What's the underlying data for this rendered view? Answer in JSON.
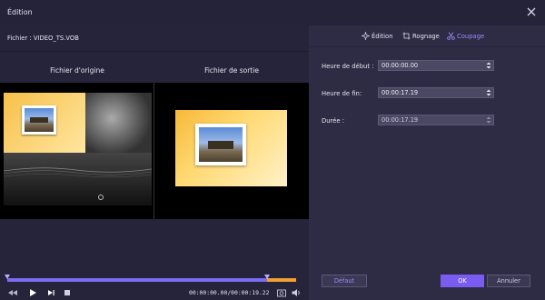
{
  "window": {
    "title": "Édition"
  },
  "file": {
    "label": "Fichier : VIDEO_TS.VOB"
  },
  "preview": {
    "original_label": "Fichier d'origine",
    "output_label": "Fichier de sortie"
  },
  "player": {
    "timecode": "00:00:00.00/00:00:19.22",
    "progress": 0,
    "trim_start": 0,
    "trim_end": 0.9
  },
  "tabs": [
    {
      "label": "Édition",
      "icon": "sparkle-icon",
      "active": false
    },
    {
      "label": "Rognage",
      "icon": "crop-icon",
      "active": false
    },
    {
      "label": "Coupage",
      "icon": "scissors-icon",
      "active": true
    }
  ],
  "trim": {
    "start_label": "Heure de début :",
    "start_value": "00:00:00.00",
    "end_label": "Heure de fin:",
    "end_value": "00:00:17.19",
    "duration_label": "Durée :",
    "duration_value": "00:00:17.19"
  },
  "buttons": {
    "default": "Défaut",
    "ok": "OK",
    "cancel": "Annuler"
  },
  "colors": {
    "accent": "#7b5cf0",
    "background": "#2a2838",
    "panel": "#2e2c44"
  }
}
